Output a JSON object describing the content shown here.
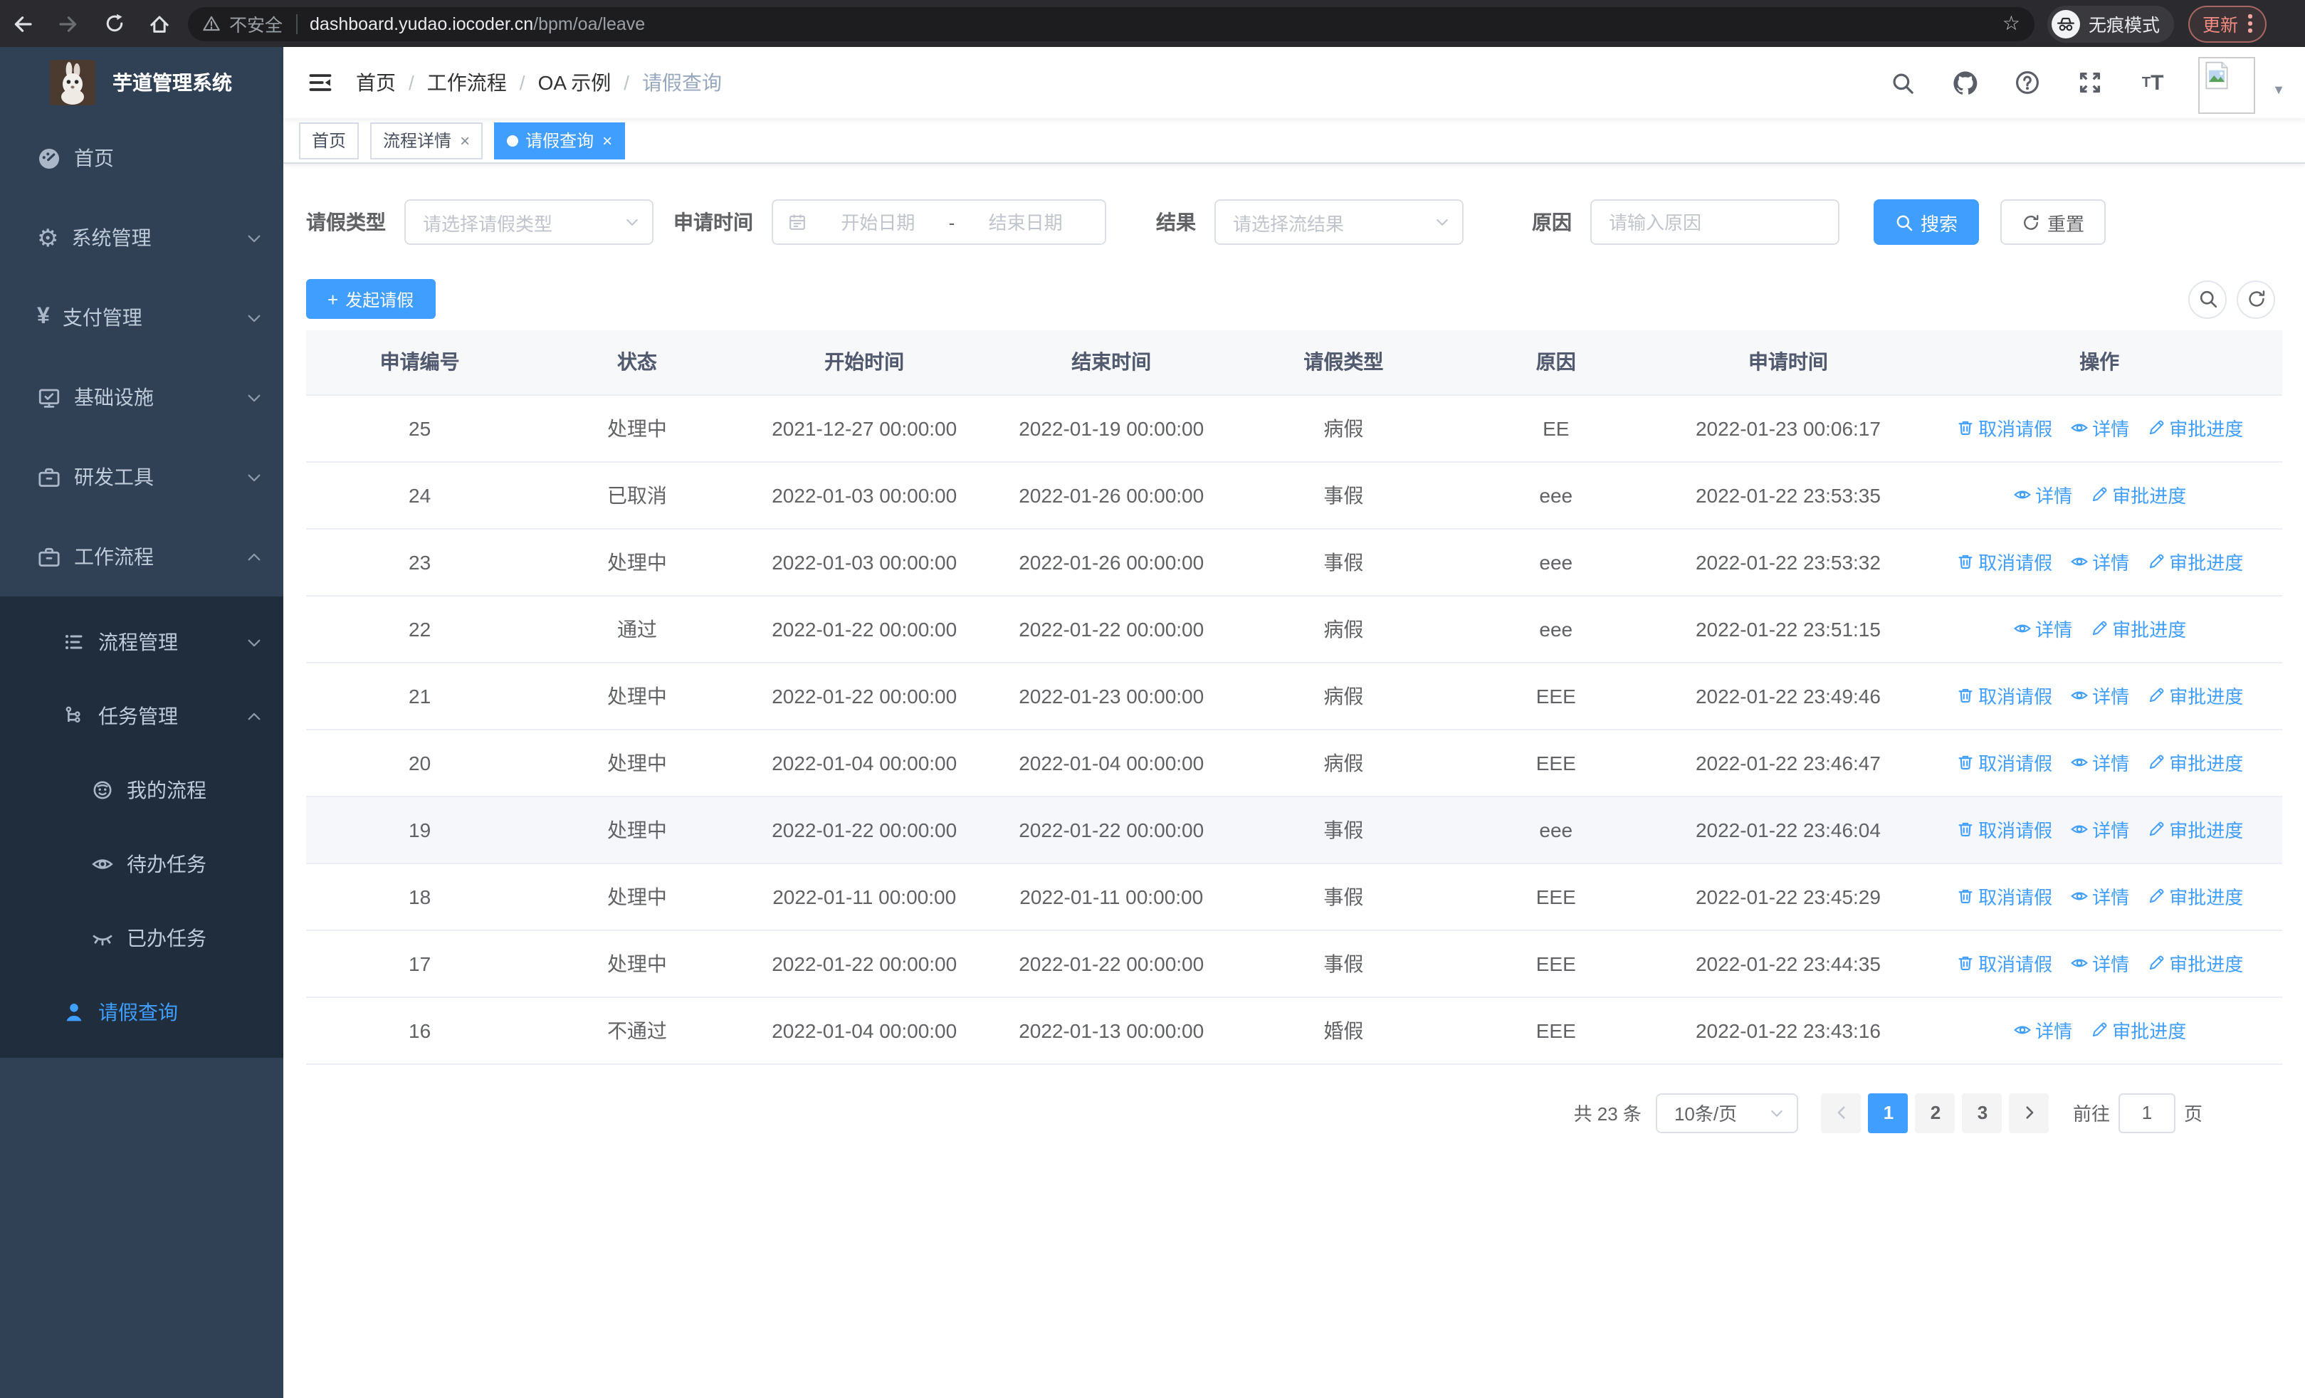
{
  "palette": {
    "accent": "#409eff",
    "sidebar_bg": "#304156",
    "submenu_bg": "#1f2d3d",
    "sidebar_text": "#bfcbd9",
    "chrome_bg": "#2b2b2f",
    "update_red": "#f28b82",
    "link_blue": "#409eff"
  },
  "icons": {
    "close": "×",
    "caret": "▼",
    "star": "☆",
    "plus": "+",
    "gear": "⚙",
    "yen": "¥"
  },
  "browser": {
    "security": "不安全",
    "host": "dashboard.yudao.iocoder.cn",
    "path": "/bpm/oa/leave",
    "incognito": "无痕模式",
    "update": "更新"
  },
  "sidebar": {
    "title": "芋道管理系统",
    "items": [
      {
        "label": "首页"
      },
      {
        "label": "系统管理"
      },
      {
        "label": "支付管理"
      },
      {
        "label": "基础设施"
      },
      {
        "label": "研发工具"
      },
      {
        "label": "工作流程"
      }
    ],
    "sub": [
      {
        "label": "流程管理"
      },
      {
        "label": "任务管理"
      },
      {
        "label": "我的流程"
      },
      {
        "label": "待办任务"
      },
      {
        "label": "已办任务"
      },
      {
        "label": "请假查询"
      }
    ]
  },
  "breadcrumb": {
    "separator": "/",
    "items": [
      "首页",
      "工作流程",
      "OA 示例",
      "请假查询"
    ]
  },
  "tabs": [
    {
      "label": "首页"
    },
    {
      "label": "流程详情"
    },
    {
      "label": "请假查询"
    }
  ],
  "filters": {
    "leave_type": {
      "label": "请假类型",
      "placeholder": "请选择请假类型"
    },
    "apply_time": {
      "label": "申请时间",
      "start": "开始日期",
      "separator": "-",
      "end": "结束日期"
    },
    "result": {
      "label": "结果",
      "placeholder": "请选择流结果"
    },
    "reason": {
      "label": "原因",
      "placeholder": "请输入原因"
    },
    "search": "搜索",
    "reset": "重置"
  },
  "toolbar": {
    "create": "发起请假"
  },
  "table": {
    "columns": [
      "申请编号",
      "状态",
      "开始时间",
      "结束时间",
      "请假类型",
      "原因",
      "申请时间",
      "操作"
    ],
    "rows": [
      {
        "id": "25",
        "status": "处理中",
        "start": "2021-12-27 00:00:00",
        "end": "2022-01-19 00:00:00",
        "type": "病假",
        "reason": "EE",
        "applied": "2022-01-23 00:06:17",
        "actions": [
          {
            "label": "取消请假"
          },
          {
            "label": "详情"
          },
          {
            "label": "审批进度"
          }
        ]
      },
      {
        "id": "24",
        "status": "已取消",
        "start": "2022-01-03 00:00:00",
        "end": "2022-01-26 00:00:00",
        "type": "事假",
        "reason": "eee",
        "applied": "2022-01-22 23:53:35",
        "actions": [
          {
            "label": "详情"
          },
          {
            "label": "审批进度"
          }
        ]
      },
      {
        "id": "23",
        "status": "处理中",
        "start": "2022-01-03 00:00:00",
        "end": "2022-01-26 00:00:00",
        "type": "事假",
        "reason": "eee",
        "applied": "2022-01-22 23:53:32",
        "actions": [
          {
            "label": "取消请假"
          },
          {
            "label": "详情"
          },
          {
            "label": "审批进度"
          }
        ]
      },
      {
        "id": "22",
        "status": "通过",
        "start": "2022-01-22 00:00:00",
        "end": "2022-01-22 00:00:00",
        "type": "病假",
        "reason": "eee",
        "applied": "2022-01-22 23:51:15",
        "actions": [
          {
            "label": "详情"
          },
          {
            "label": "审批进度"
          }
        ]
      },
      {
        "id": "21",
        "status": "处理中",
        "start": "2022-01-22 00:00:00",
        "end": "2022-01-23 00:00:00",
        "type": "病假",
        "reason": "EEE",
        "applied": "2022-01-22 23:49:46",
        "actions": [
          {
            "label": "取消请假"
          },
          {
            "label": "详情"
          },
          {
            "label": "审批进度"
          }
        ]
      },
      {
        "id": "20",
        "status": "处理中",
        "start": "2022-01-04 00:00:00",
        "end": "2022-01-04 00:00:00",
        "type": "病假",
        "reason": "EEE",
        "applied": "2022-01-22 23:46:47",
        "actions": [
          {
            "label": "取消请假"
          },
          {
            "label": "详情"
          },
          {
            "label": "审批进度"
          }
        ]
      },
      {
        "id": "19",
        "status": "处理中",
        "start": "2022-01-22 00:00:00",
        "end": "2022-01-22 00:00:00",
        "type": "事假",
        "reason": "eee",
        "applied": "2022-01-22 23:46:04",
        "actions": [
          {
            "label": "取消请假"
          },
          {
            "label": "详情"
          },
          {
            "label": "审批进度"
          }
        ]
      },
      {
        "id": "18",
        "status": "处理中",
        "start": "2022-01-11 00:00:00",
        "end": "2022-01-11 00:00:00",
        "type": "事假",
        "reason": "EEE",
        "applied": "2022-01-22 23:45:29",
        "actions": [
          {
            "label": "取消请假"
          },
          {
            "label": "详情"
          },
          {
            "label": "审批进度"
          }
        ]
      },
      {
        "id": "17",
        "status": "处理中",
        "start": "2022-01-22 00:00:00",
        "end": "2022-01-22 00:00:00",
        "type": "事假",
        "reason": "EEE",
        "applied": "2022-01-22 23:44:35",
        "actions": [
          {
            "label": "取消请假"
          },
          {
            "label": "详情"
          },
          {
            "label": "审批进度"
          }
        ]
      },
      {
        "id": "16",
        "status": "不通过",
        "start": "2022-01-04 00:00:00",
        "end": "2022-01-13 00:00:00",
        "type": "婚假",
        "reason": "EEE",
        "applied": "2022-01-22 23:43:16",
        "actions": [
          {
            "label": "详情"
          },
          {
            "label": "审批进度"
          }
        ]
      }
    ]
  },
  "pagination": {
    "total": "共 23 条",
    "page_size": "10条/页",
    "pages": [
      "1",
      "2",
      "3"
    ],
    "active_page": "1",
    "goto": "前往",
    "goto_value": "1",
    "unit": "页"
  }
}
